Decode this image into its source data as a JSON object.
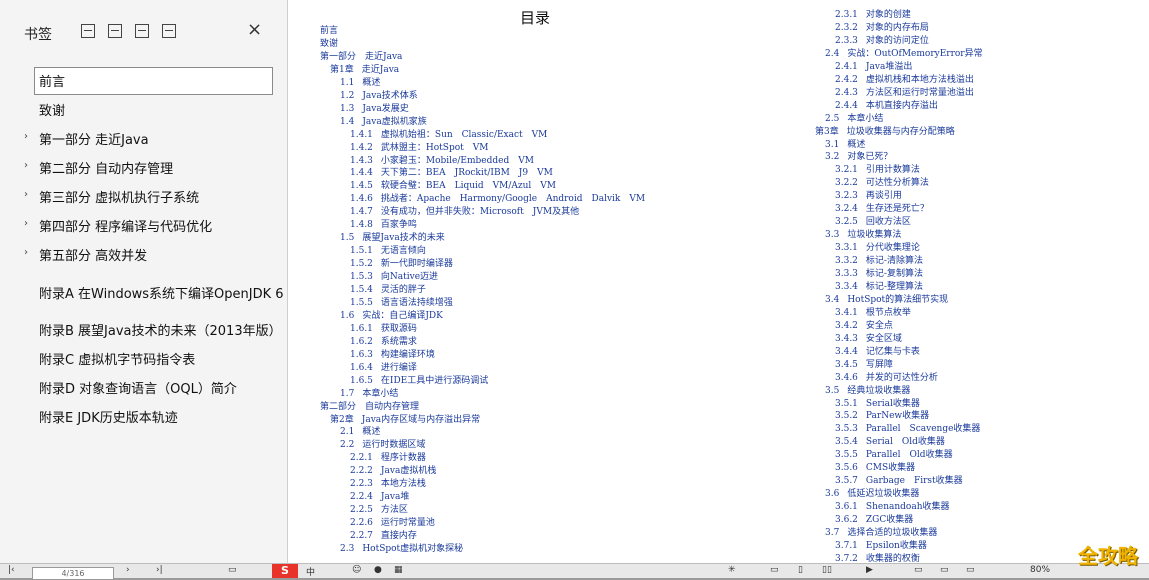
{
  "sidebar": {
    "title": "书签",
    "icons": [
      "expand-all-icon",
      "collapse-all-icon",
      "add-bookmark-icon",
      "bookmark-properties-icon"
    ],
    "close_label": "×",
    "items": [
      {
        "label": "前言",
        "arrow": "",
        "selected": true
      },
      {
        "label": "致谢",
        "arrow": "",
        "selected": false
      },
      {
        "label": "第一部分 走近Java",
        "arrow": "›",
        "selected": false
      },
      {
        "label": "第二部分 自动内存管理",
        "arrow": "›",
        "selected": false
      },
      {
        "label": "第三部分 虚拟机执行子系统",
        "arrow": "›",
        "selected": false
      },
      {
        "label": "第四部分 程序编译与代码优化",
        "arrow": "›",
        "selected": false
      },
      {
        "label": "第五部分 高效并发",
        "arrow": "›",
        "selected": false
      },
      {
        "label": "附录A 在Windows系统下编译OpenJDK 6",
        "arrow": "",
        "selected": false
      },
      {
        "label": "附录B 展望Java技术的未来（2013年版）",
        "arrow": "",
        "selected": false
      },
      {
        "label": "附录C 虚拟机字节码指令表",
        "arrow": "",
        "selected": false
      },
      {
        "label": "附录D 对象查询语言（OQL）简介",
        "arrow": "",
        "selected": false
      },
      {
        "label": "附录E JDK历史版本轨迹",
        "arrow": "",
        "selected": false
      }
    ]
  },
  "toc": {
    "title": "目录",
    "left": [
      {
        "level": 0,
        "num": "",
        "text": "前言"
      },
      {
        "level": 0,
        "num": "",
        "text": "致谢"
      },
      {
        "level": 0,
        "num": "",
        "text": "第一部分　走近Java"
      },
      {
        "level": 1,
        "num": "第1章",
        "text": "走近Java"
      },
      {
        "level": 2,
        "num": "1.1",
        "text": "概述"
      },
      {
        "level": 2,
        "num": "1.2",
        "text": "Java技术体系"
      },
      {
        "level": 2,
        "num": "1.3",
        "text": "Java发展史"
      },
      {
        "level": 2,
        "num": "1.4",
        "text": "Java虚拟机家族"
      },
      {
        "level": 3,
        "num": "1.4.1",
        "text": "虚拟机始祖：Sun　Classic/Exact　VM"
      },
      {
        "level": 3,
        "num": "1.4.2",
        "text": "武林盟主：HotSpot　VM"
      },
      {
        "level": 3,
        "num": "1.4.3",
        "text": "小家碧玉：Mobile/Embedded　VM"
      },
      {
        "level": 3,
        "num": "1.4.4",
        "text": "天下第二：BEA　JRockit/IBM　J9　VM"
      },
      {
        "level": 3,
        "num": "1.4.5",
        "text": "软硬合璧：BEA　Liquid　VM/Azul　VM"
      },
      {
        "level": 3,
        "num": "1.4.6",
        "text": "挑战者：Apache　Harmony/Google　Android　Dalvik　VM"
      },
      {
        "level": 3,
        "num": "1.4.7",
        "text": "没有成功，但并非失败：Microsoft　JVM及其他"
      },
      {
        "level": 3,
        "num": "1.4.8",
        "text": "百家争鸣"
      },
      {
        "level": 2,
        "num": "1.5",
        "text": "展望Java技术的未来"
      },
      {
        "level": 3,
        "num": "1.5.1",
        "text": "无语言倾向"
      },
      {
        "level": 3,
        "num": "1.5.2",
        "text": "新一代即时编译器"
      },
      {
        "level": 3,
        "num": "1.5.3",
        "text": "向Native迈进"
      },
      {
        "level": 3,
        "num": "1.5.4",
        "text": "灵活的胖子"
      },
      {
        "level": 3,
        "num": "1.5.5",
        "text": "语言语法持续增强"
      },
      {
        "level": 2,
        "num": "1.6",
        "text": "实战：自己编译JDK"
      },
      {
        "level": 3,
        "num": "1.6.1",
        "text": "获取源码"
      },
      {
        "level": 3,
        "num": "1.6.2",
        "text": "系统需求"
      },
      {
        "level": 3,
        "num": "1.6.3",
        "text": "构建编译环境"
      },
      {
        "level": 3,
        "num": "1.6.4",
        "text": "进行编译"
      },
      {
        "level": 3,
        "num": "1.6.5",
        "text": "在IDE工具中进行源码调试"
      },
      {
        "level": 2,
        "num": "1.7",
        "text": "本章小结"
      },
      {
        "level": 0,
        "num": "",
        "text": "第二部分　自动内存管理"
      },
      {
        "level": 1,
        "num": "第2章",
        "text": "Java内存区域与内存溢出异常"
      },
      {
        "level": 2,
        "num": "2.1",
        "text": "概述"
      },
      {
        "level": 2,
        "num": "2.2",
        "text": "运行时数据区域"
      },
      {
        "level": 3,
        "num": "2.2.1",
        "text": "程序计数器"
      },
      {
        "level": 3,
        "num": "2.2.2",
        "text": "Java虚拟机栈"
      },
      {
        "level": 3,
        "num": "2.2.3",
        "text": "本地方法栈"
      },
      {
        "level": 3,
        "num": "2.2.4",
        "text": "Java堆"
      },
      {
        "level": 3,
        "num": "2.2.5",
        "text": "方法区"
      },
      {
        "level": 3,
        "num": "2.2.6",
        "text": "运行时常量池"
      },
      {
        "level": 3,
        "num": "2.2.7",
        "text": "直接内存"
      },
      {
        "level": 2,
        "num": "2.3",
        "text": "HotSpot虚拟机对象探秘"
      }
    ],
    "right": [
      {
        "level": 3,
        "num": "2.3.1",
        "text": "对象的创建"
      },
      {
        "level": 3,
        "num": "2.3.2",
        "text": "对象的内存布局"
      },
      {
        "level": 3,
        "num": "2.3.3",
        "text": "对象的访问定位"
      },
      {
        "level": 2,
        "num": "2.4",
        "text": "实战：OutOfMemoryError异常"
      },
      {
        "level": 3,
        "num": "2.4.1",
        "text": "Java堆溢出"
      },
      {
        "level": 3,
        "num": "2.4.2",
        "text": "虚拟机栈和本地方法栈溢出"
      },
      {
        "level": 3,
        "num": "2.4.3",
        "text": "方法区和运行时常量池溢出"
      },
      {
        "level": 3,
        "num": "2.4.4",
        "text": "本机直接内存溢出"
      },
      {
        "level": 2,
        "num": "2.5",
        "text": "本章小结"
      },
      {
        "level": 1,
        "num": "第3章",
        "text": "垃圾收集器与内存分配策略"
      },
      {
        "level": 2,
        "num": "3.1",
        "text": "概述"
      },
      {
        "level": 2,
        "num": "3.2",
        "text": "对象已死？"
      },
      {
        "level": 3,
        "num": "3.2.1",
        "text": "引用计数算法"
      },
      {
        "level": 3,
        "num": "3.2.2",
        "text": "可达性分析算法"
      },
      {
        "level": 3,
        "num": "3.2.3",
        "text": "再谈引用"
      },
      {
        "level": 3,
        "num": "3.2.4",
        "text": "生存还是死亡？"
      },
      {
        "level": 3,
        "num": "3.2.5",
        "text": "回收方法区"
      },
      {
        "level": 2,
        "num": "3.3",
        "text": "垃圾收集算法"
      },
      {
        "level": 3,
        "num": "3.3.1",
        "text": "分代收集理论"
      },
      {
        "level": 3,
        "num": "3.3.2",
        "text": "标记-清除算法"
      },
      {
        "level": 3,
        "num": "3.3.3",
        "text": "标记-复制算法"
      },
      {
        "level": 3,
        "num": "3.3.4",
        "text": "标记-整理算法"
      },
      {
        "level": 2,
        "num": "3.4",
        "text": "HotSpot的算法细节实现"
      },
      {
        "level": 3,
        "num": "3.4.1",
        "text": "根节点枚举"
      },
      {
        "level": 3,
        "num": "3.4.2",
        "text": "安全点"
      },
      {
        "level": 3,
        "num": "3.4.3",
        "text": "安全区域"
      },
      {
        "level": 3,
        "num": "3.4.4",
        "text": "记忆集与卡表"
      },
      {
        "level": 3,
        "num": "3.4.5",
        "text": "写屏障"
      },
      {
        "level": 3,
        "num": "3.4.6",
        "text": "并发的可达性分析"
      },
      {
        "level": 2,
        "num": "3.5",
        "text": "经典垃圾收集器"
      },
      {
        "level": 3,
        "num": "3.5.1",
        "text": "Serial收集器"
      },
      {
        "level": 3,
        "num": "3.5.2",
        "text": "ParNew收集器"
      },
      {
        "level": 3,
        "num": "3.5.3",
        "text": "Parallel　Scavenge收集器"
      },
      {
        "level": 3,
        "num": "3.5.4",
        "text": "Serial　Old收集器"
      },
      {
        "level": 3,
        "num": "3.5.5",
        "text": "Parallel　Old收集器"
      },
      {
        "level": 3,
        "num": "3.5.6",
        "text": "CMS收集器"
      },
      {
        "level": 3,
        "num": "3.5.7",
        "text": "Garbage　First收集器"
      },
      {
        "level": 2,
        "num": "3.6",
        "text": "低延迟垃圾收集器"
      },
      {
        "level": 3,
        "num": "3.6.1",
        "text": "Shenandoah收集器"
      },
      {
        "level": 3,
        "num": "3.6.2",
        "text": "ZGC收集器"
      },
      {
        "level": 2,
        "num": "3.7",
        "text": "选择合适的垃圾收集器"
      },
      {
        "level": 3,
        "num": "3.7.1",
        "text": "Epsilon收集器"
      },
      {
        "level": 3,
        "num": "3.7.2",
        "text": "收集器的权衡"
      }
    ]
  },
  "statusbar": {
    "page_indicator": "4/316",
    "zoom": "80%",
    "ime_label": "S",
    "ime_mode": "中"
  },
  "watermark": "全攻略"
}
